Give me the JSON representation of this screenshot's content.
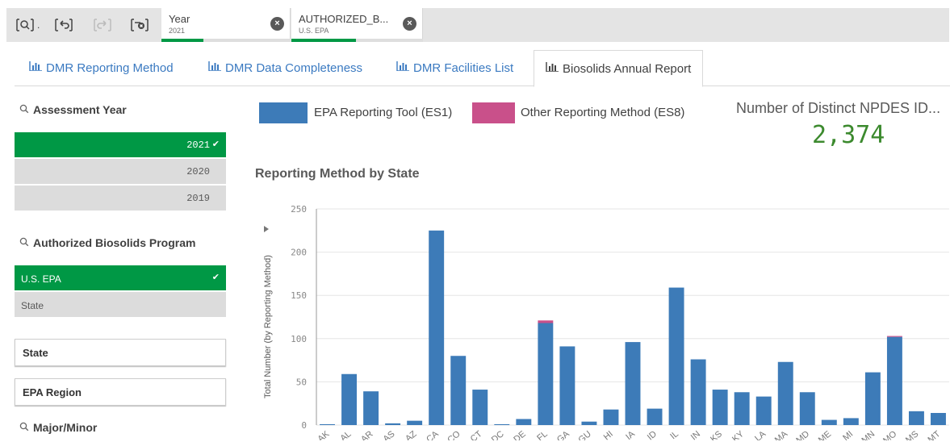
{
  "selections": {
    "chips": [
      {
        "title": "Year",
        "value": "2021"
      },
      {
        "title": "AUTHORIZED_B...",
        "value": "U.S. EPA"
      }
    ]
  },
  "tabs": [
    {
      "label": "DMR Reporting Method"
    },
    {
      "label": "DMR Data Completeness"
    },
    {
      "label": "DMR Facilities List"
    },
    {
      "label": "Biosolids Annual Report"
    }
  ],
  "filters": {
    "assessment_year": {
      "title": "Assessment Year",
      "items": [
        "2021",
        "2020",
        "2019"
      ]
    },
    "program": {
      "title": "Authorized Biosolids Program",
      "items": [
        "U.S. EPA",
        "State"
      ]
    },
    "state_label": "State",
    "region_label": "EPA Region",
    "major_minor_title": "Major/Minor"
  },
  "legend": {
    "es1": "EPA Reporting Tool (ES1)",
    "es8": "Other Reporting Method (ES8)"
  },
  "kpi": {
    "label": "Number of Distinct NPDES ID...",
    "value": "2,374"
  },
  "colors": {
    "es1": "#3d7bb8",
    "es8": "#c9508a",
    "selected": "#009845",
    "accent_link": "#3b7ac1"
  },
  "chart_data": {
    "type": "bar",
    "title": "Reporting Method by State",
    "ylabel": "Total Number (by Reporting Method)",
    "ylim": [
      0,
      250
    ],
    "yticks": [
      "0",
      "50",
      "100",
      "150",
      "200",
      "250"
    ],
    "categories": [
      "AK",
      "AL",
      "AR",
      "AS",
      "AZ",
      "CA",
      "CO",
      "CT",
      "DC",
      "DE",
      "FL",
      "GA",
      "GU",
      "HI",
      "IA",
      "ID",
      "IL",
      "IN",
      "KS",
      "KY",
      "LA",
      "MA",
      "MD",
      "ME",
      "MI",
      "MN",
      "MO",
      "MS",
      "MT"
    ],
    "series": [
      {
        "name": "EPA Reporting Tool (ES1)",
        "values": [
          1,
          59,
          39,
          2,
          5,
          225,
          80,
          41,
          1,
          7,
          118,
          91,
          4,
          18,
          96,
          19,
          159,
          76,
          41,
          38,
          33,
          73,
          38,
          6,
          8,
          61,
          102,
          16,
          14
        ]
      },
      {
        "name": "Other Reporting Method (ES8)",
        "values": [
          0,
          0,
          0,
          0,
          0,
          0,
          0,
          0,
          0,
          0,
          3,
          0,
          0,
          0,
          0,
          0,
          0,
          0,
          0,
          0,
          0,
          0,
          0,
          0,
          0,
          0,
          1,
          0,
          0
        ]
      }
    ],
    "stacked": true,
    "grid": true
  }
}
